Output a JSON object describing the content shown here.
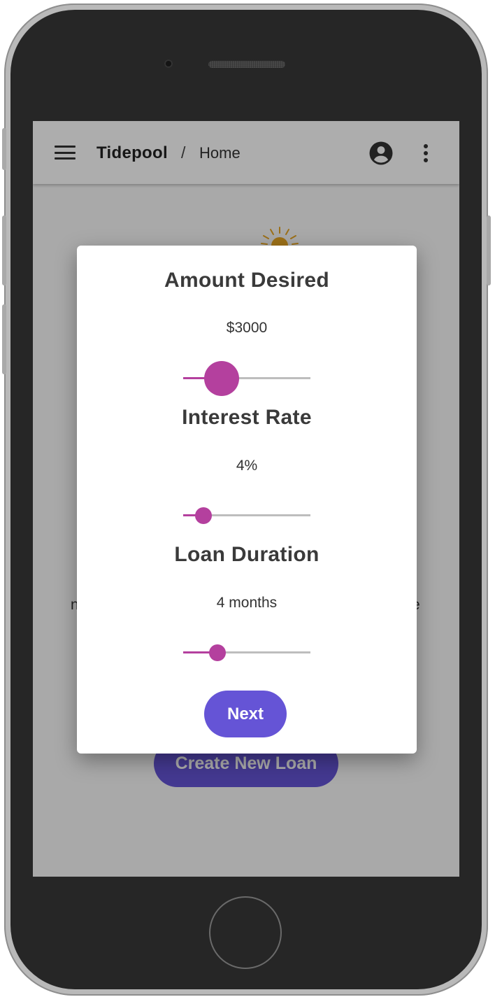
{
  "appbar": {
    "brand": "Tidepool",
    "separator": "/",
    "breadcrumb": "Home"
  },
  "background": {
    "left_text_fragment": "n",
    "right_text_fragment": "e",
    "create_button_label": "Create New Loan"
  },
  "dialog": {
    "sections": [
      {
        "title": "Amount Desired",
        "value": "$3000",
        "slider_fraction": 0.3
      },
      {
        "title": "Interest Rate",
        "value": "4%",
        "slider_fraction": 0.16
      },
      {
        "title": "Loan Duration",
        "value": "4 months",
        "slider_fraction": 0.27
      }
    ],
    "next_label": "Next"
  },
  "colors": {
    "accent": "#b4409e",
    "primary_button": "#6554d6"
  },
  "icons": {
    "menu": "menu-icon",
    "account": "account-circle-icon",
    "more": "more-vert-icon",
    "illustration": "sun-icon"
  }
}
